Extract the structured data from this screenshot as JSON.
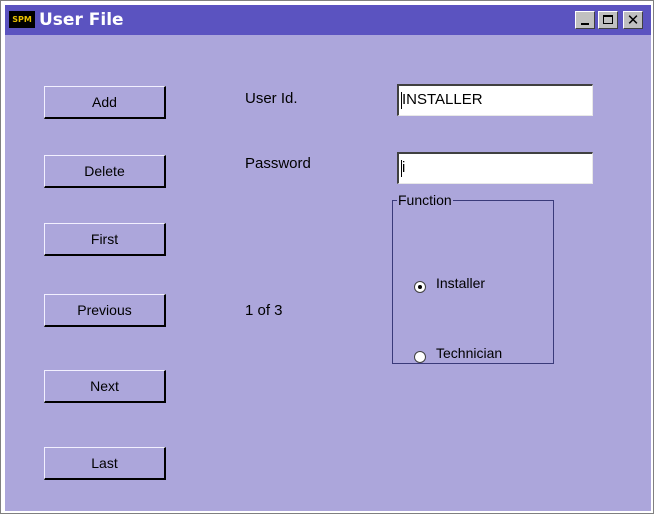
{
  "window": {
    "icon_text": "SPM",
    "title": "User File",
    "minimize_glyph": "",
    "close_glyph": "✕"
  },
  "buttons": {
    "add": "Add",
    "delete": "Delete",
    "first": "First",
    "previous": "Previous",
    "next": "Next",
    "last": "Last"
  },
  "form": {
    "user_id_label": "User Id.",
    "user_id_value": "INSTALLER",
    "password_label": "Password",
    "password_value": "i",
    "record_position": "1 of 3"
  },
  "function_group": {
    "label": "Function",
    "options": [
      {
        "label": "Installer",
        "selected": true
      },
      {
        "label": "Technician",
        "selected": false
      }
    ]
  },
  "colors": {
    "title_bar": "#5B53C0",
    "client_bg": "#ACA6DB"
  }
}
